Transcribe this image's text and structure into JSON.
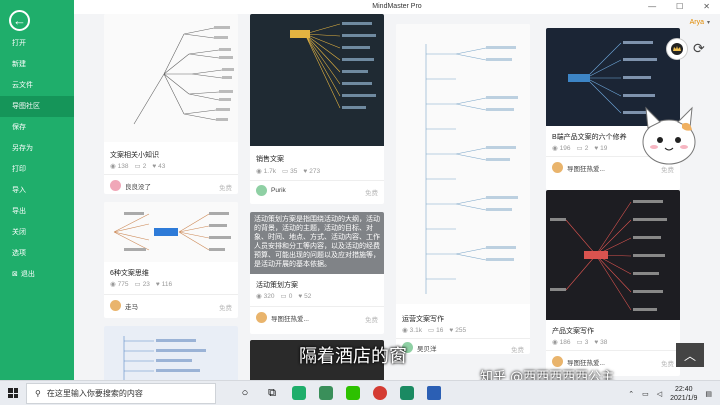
{
  "app": {
    "title": "MindMaster Pro"
  },
  "user": {
    "name": "Arya"
  },
  "sidebar": {
    "items": [
      {
        "label": "打开"
      },
      {
        "label": "新建"
      },
      {
        "label": "云文件"
      },
      {
        "label": "导图社区"
      },
      {
        "label": "保存"
      },
      {
        "label": "另存为"
      },
      {
        "label": "打印"
      },
      {
        "label": "导入"
      },
      {
        "label": "导出"
      },
      {
        "label": "关闭"
      },
      {
        "label": "选项"
      },
      {
        "label": "退出"
      }
    ]
  },
  "cards": [
    {
      "title": "文案相关小知识",
      "views": "138",
      "comments": "2",
      "likes": "43",
      "author": "良良没了",
      "price": "免费"
    },
    {
      "title": "销售文案",
      "views": "1.7k",
      "comments": "35",
      "likes": "273",
      "author": "Purik",
      "price": "免费"
    },
    {
      "title": "B端产品文案的六个修养",
      "views": "196",
      "comments": "2",
      "likes": "19",
      "author": "导图狂热爱...",
      "price": "免费"
    },
    {
      "title": "6种文案思维",
      "views": "775",
      "comments": "23",
      "likes": "116",
      "author": "走马",
      "price": "免费"
    },
    {
      "title": "活动策划方案",
      "views": "320",
      "comments": "0",
      "likes": "52",
      "author": "导图狂热爱...",
      "price": "免费",
      "overlay": "活动策划方案是指围绕活动的大纲，活动的背景，活动的主题，活动的目标、对象、时间、地点、方式、活动内容、工作人员安排和分工等内容，以及活动的经费预算、可能出现的问题以及应对措施等，是活动开展的基本依据。"
    },
    {
      "title": "运营文案写作",
      "views": "3.1k",
      "comments": "16",
      "likes": "255",
      "author": "吴贝洋",
      "price": "免费"
    },
    {
      "title": "产品文案写作",
      "views": "186",
      "comments": "3",
      "likes": "38",
      "author": "导图狂热爱...",
      "price": "免费"
    }
  ],
  "overlay": {
    "subtitle": "隔着酒店的窗",
    "watermark": "知乎 @西西西西西公主"
  },
  "taskbar": {
    "search_placeholder": "在这里输入你要搜索的内容",
    "time": "22:40",
    "date": "2021/1/9"
  }
}
